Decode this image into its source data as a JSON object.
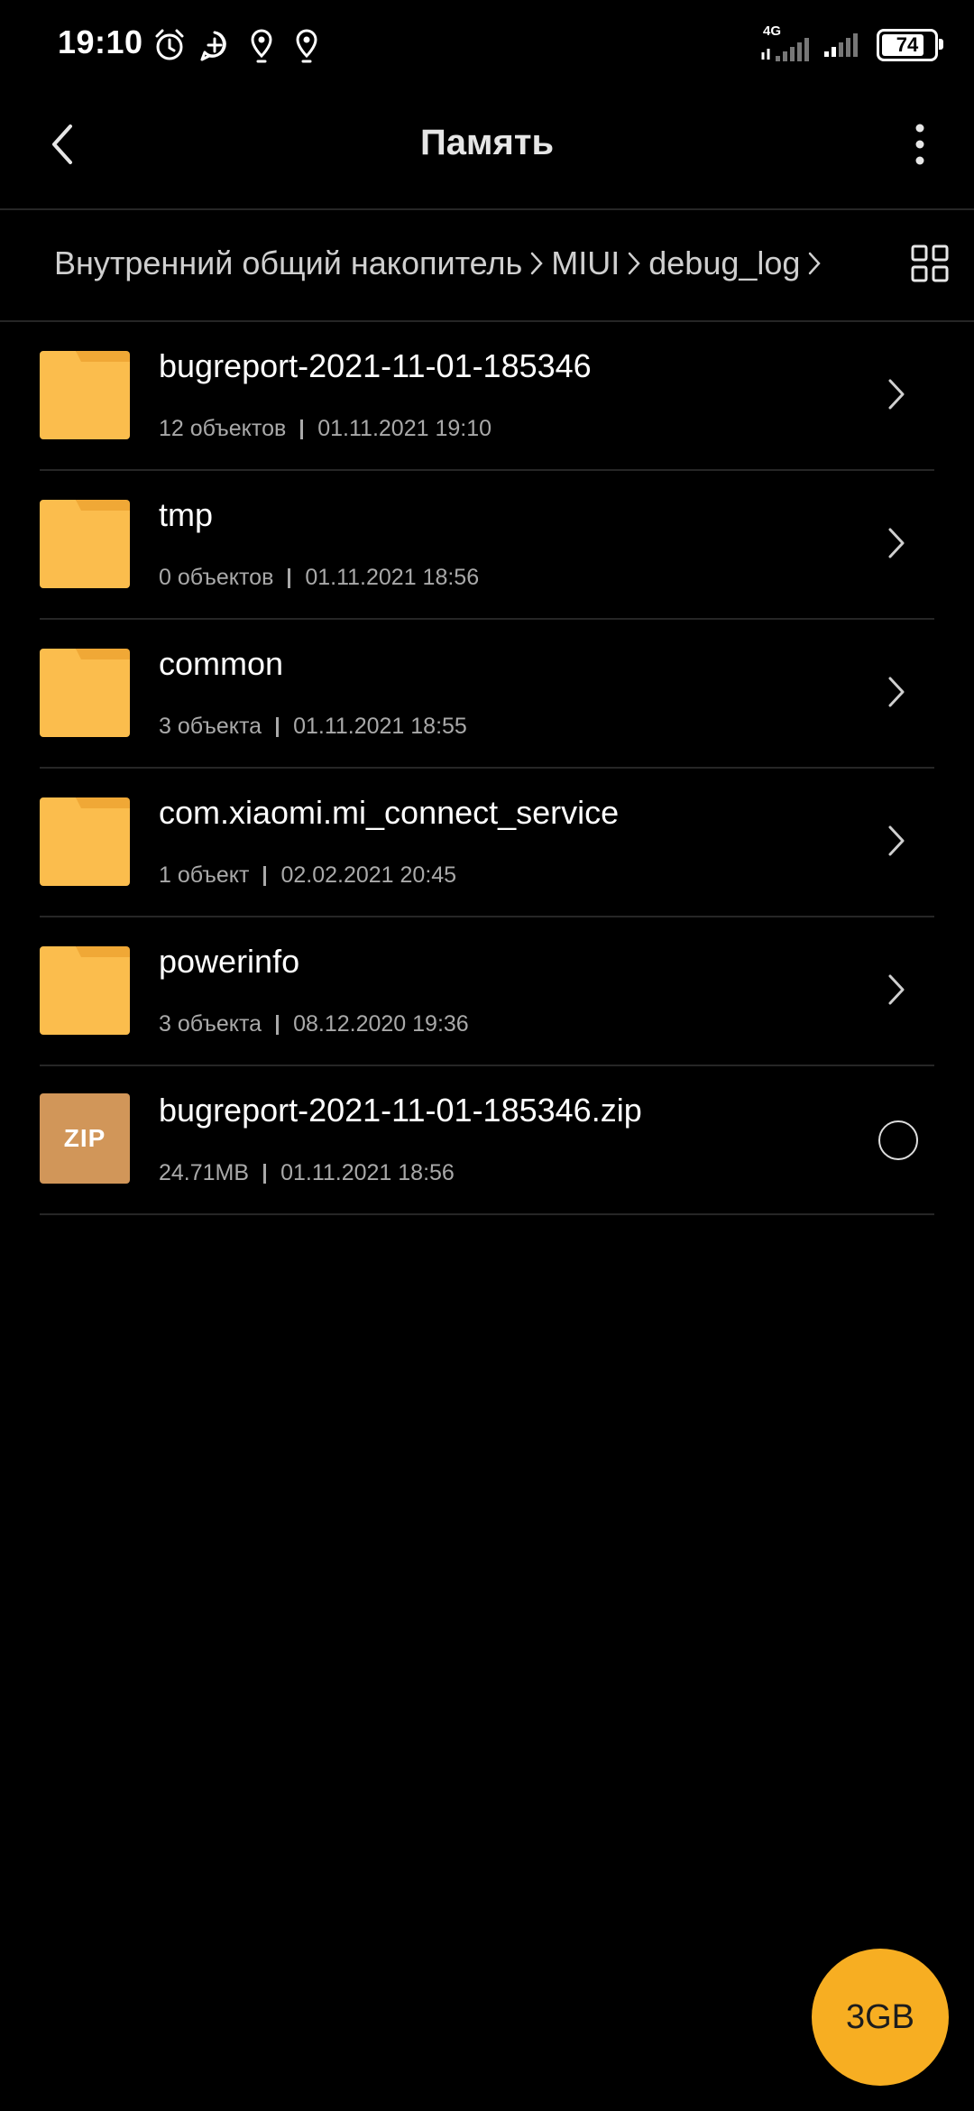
{
  "status_bar": {
    "time": "19:10",
    "network": "4G",
    "battery": "74",
    "icons": [
      "alarm-icon",
      "plus-bubble-icon",
      "location-icon",
      "location-icon",
      "signal-icon",
      "signal-icon"
    ]
  },
  "header": {
    "title": "Память"
  },
  "breadcrumb": {
    "items": [
      "Внутренний общий накопитель",
      "MIUI",
      "debug_log"
    ]
  },
  "list": {
    "items": [
      {
        "name": "bugreport-2021-11-01-185346",
        "count": "12 объектов",
        "date": "01.11.2021 19:10",
        "type": "folder"
      },
      {
        "name": "tmp",
        "count": "0 объектов",
        "date": "01.11.2021 18:56",
        "type": "folder"
      },
      {
        "name": "common",
        "count": "3 объекта",
        "date": "01.11.2021 18:55",
        "type": "folder"
      },
      {
        "name": "com.xiaomi.mi_connect_service",
        "count": "1 объект",
        "date": "02.02.2021 20:45",
        "type": "folder"
      },
      {
        "name": "powerinfo",
        "count": "3 объекта",
        "date": "08.12.2020 19:36",
        "type": "folder"
      },
      {
        "name": "bugreport-2021-11-01-185346.zip",
        "count": "24.71MB",
        "date": "01.11.2021 18:56",
        "type": "zip",
        "zip_label": "ZIP"
      }
    ]
  },
  "fab": {
    "label": "3GB"
  },
  "colors": {
    "background": "#000000",
    "folder": "#fbbd4d",
    "folder_tab": "#f0a836",
    "zip": "#d19659",
    "fab": "#f7ae22"
  }
}
